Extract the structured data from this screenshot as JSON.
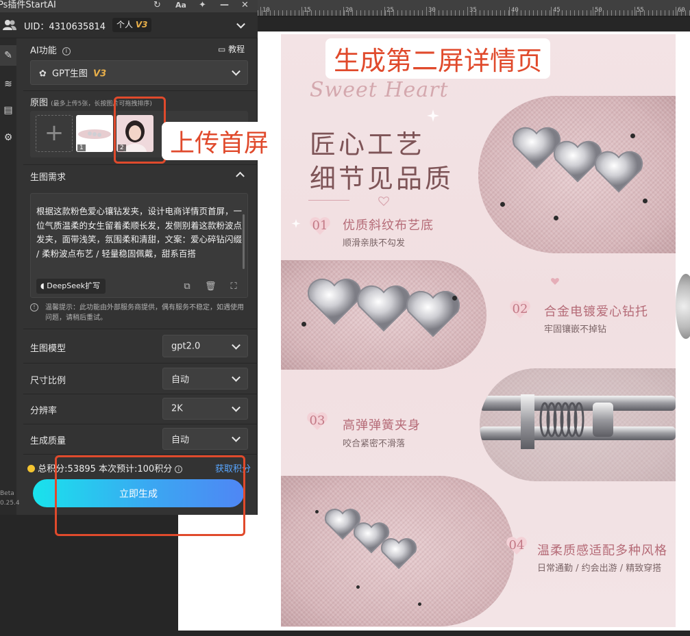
{
  "plugin": {
    "window_title": "Ps插件StartAI",
    "uid_label": "UID：4310635814",
    "account_type": "个人",
    "account_version": "V3",
    "ai_function_label": "AI功能",
    "tutorial_label": "教程",
    "model_family": "GPT生图",
    "model_family_version": "V3",
    "source_images_label": "原图",
    "source_images_hint": "(最多上传5张，长按图片可拖拽排序)",
    "thumb_1_index": "1",
    "thumb_2_index": "2",
    "requirements_label": "生图需求",
    "prompt_text": "根据这款粉色爱心镶钻发夹，设计电商详情页首屏，一位气质温柔的女生留着柔顺长发，发侧别着这款粉波点发夹，面带浅笑，氛围柔和清甜，文案：爱心碎钻闪缀 / 柔粉波点布艺 / 轻量稳固佩戴，甜系百搭",
    "deepseek_label": "DeepSeek扩写",
    "notice": "温馨提示：此功能由外部服务商提供，偶有服务不稳定，如遇使用问题，请稍后重试。",
    "settings": [
      {
        "label": "生图模型",
        "value": "gpt2.0"
      },
      {
        "label": "尺寸比例",
        "value": "自动"
      },
      {
        "label": "分辨率",
        "value": "2K"
      },
      {
        "label": "生成质量",
        "value": "自动"
      }
    ],
    "credits_text": "总积分:53895  本次预计:100积分",
    "get_credits": "获取积分",
    "generate_button": "立即生成",
    "beta_label": "Beta",
    "version_label": "0.25.4"
  },
  "ruler": {
    "ticks": [
      "10",
      "15",
      "20",
      "25",
      "30",
      "35",
      "40",
      "45",
      "50",
      "55",
      "60"
    ]
  },
  "annotations": {
    "heading": "生成第二屏详情页",
    "upload": "上传首屏"
  },
  "document": {
    "script_title": "Sweet Heart",
    "headline_1": "匠心工艺",
    "headline_2": "细节见品质",
    "features": [
      {
        "num": "01",
        "title": "优质斜纹布艺底",
        "subtitle": "顺滑亲肤不勾发"
      },
      {
        "num": "02",
        "title": "合金电镀爱心钻托",
        "subtitle": "牢固镶嵌不掉钻"
      },
      {
        "num": "03",
        "title": "高弹弹簧夹身",
        "subtitle": "咬合紧密不滑落"
      },
      {
        "num": "04",
        "title": "温柔质感适配多种风格",
        "subtitle": "日常通勤 / 约会出游 / 精致穿搭"
      }
    ]
  },
  "colors": {
    "accent_red": "#e04a2c",
    "button_start": "#19e3ec",
    "button_end": "#4f86f4",
    "link_blue": "#58a6ff",
    "headline": "#7e5457",
    "feature_pink": "#b56b77"
  },
  "icons": {
    "refresh": "refresh-icon",
    "font": "font-size-icon",
    "pin": "pin-icon",
    "minimize": "minimize-icon",
    "close": "close-icon",
    "users": "users-icon",
    "edit": "edit-icon",
    "layers": "layers-icon",
    "history": "history-icon",
    "settings": "gear-icon"
  }
}
